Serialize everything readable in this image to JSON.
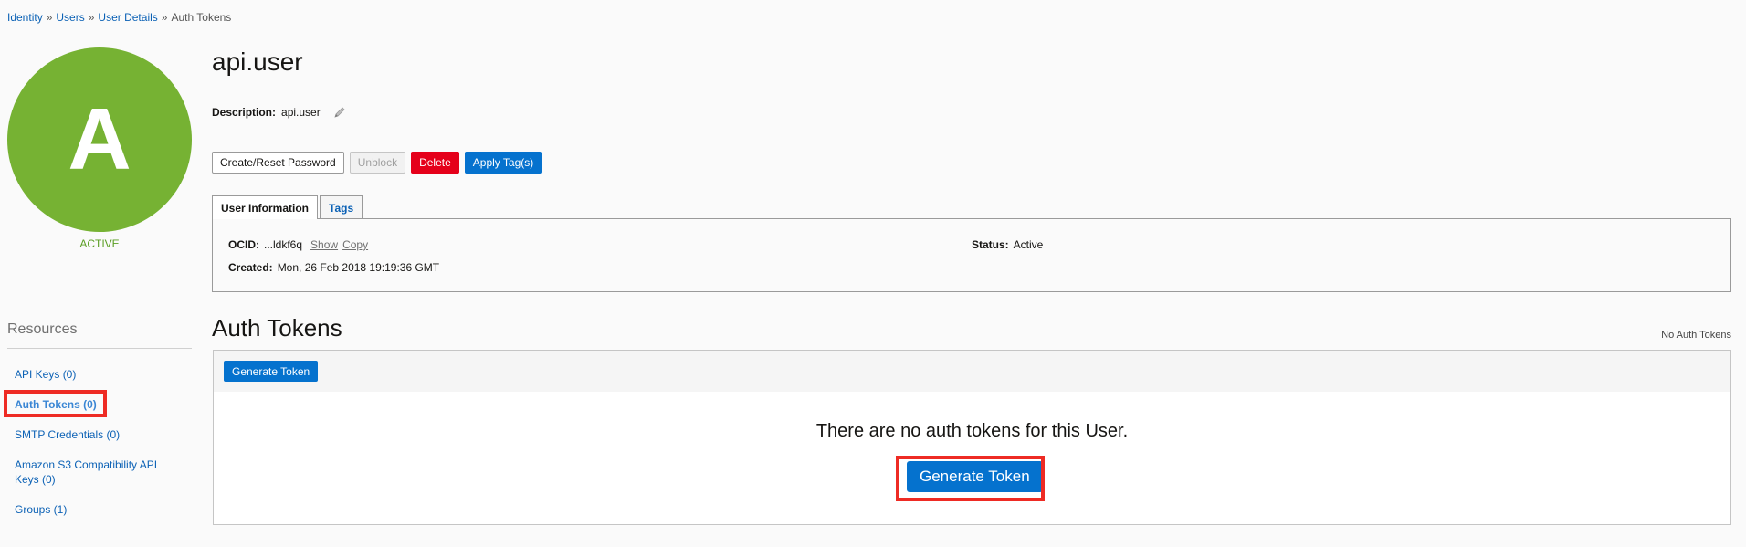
{
  "breadcrumb": {
    "items": [
      "Identity",
      "Users",
      "User Details"
    ],
    "current": "Auth Tokens",
    "separator": "»"
  },
  "avatar": {
    "letter": "A",
    "state": "ACTIVE",
    "color": "#76b233"
  },
  "user": {
    "name": "api.user",
    "description_label": "Description:",
    "description_value": "api.user"
  },
  "actions": {
    "create_reset_password": "Create/Reset Password",
    "unblock": "Unblock",
    "delete": "Delete",
    "apply_tags": "Apply Tag(s)"
  },
  "tabs": {
    "user_information": "User Information",
    "tags": "Tags"
  },
  "info": {
    "ocid_label": "OCID:",
    "ocid_value": "...ldkf6q",
    "show": "Show",
    "copy": "Copy",
    "created_label": "Created:",
    "created_value": "Mon, 26 Feb 2018 19:19:36 GMT",
    "status_label": "Status:",
    "status_value": "Active"
  },
  "resources": {
    "title": "Resources",
    "items": [
      "API Keys (0)",
      "Auth Tokens (0)",
      "SMTP Credentials (0)",
      "Amazon S3 Compatibility API Keys (0)",
      "Groups (1)"
    ],
    "active_index": 1
  },
  "auth_tokens": {
    "title": "Auth Tokens",
    "count_note": "No Auth Tokens",
    "toolbar_button": "Generate Token",
    "empty_message": "There are no auth tokens for this User.",
    "empty_button": "Generate Token"
  },
  "colors": {
    "link": "#0b61b5",
    "primary": "#0572ce",
    "danger": "#e5001a",
    "highlight": "#ee2b24",
    "active_state": "#5a9e23"
  }
}
